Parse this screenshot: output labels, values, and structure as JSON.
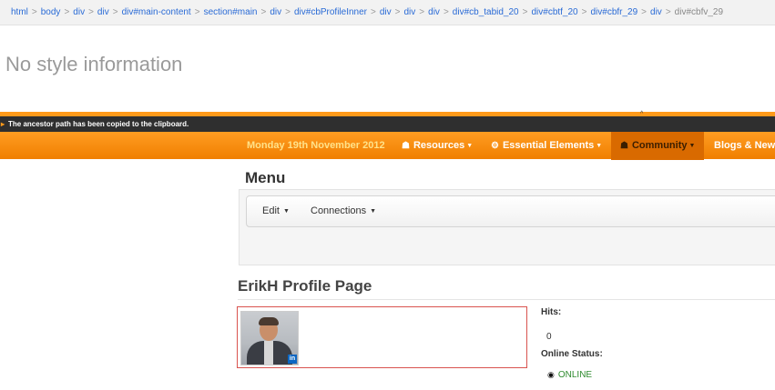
{
  "breadcrumb": [
    "html",
    "body",
    "div",
    "div",
    "div#main-content",
    "section#main",
    "div",
    "div#cbProfileInner",
    "div",
    "div",
    "div",
    "div#cb_tabid_20",
    "div#cbtf_20",
    "div#cbfr_29",
    "div",
    "div#cbfv_29"
  ],
  "no_style": "No style information",
  "toast": "The ancestor path has been copied to the clipboard.",
  "topline_mark": "^",
  "nav": {
    "date": "Monday 19th November 2012",
    "items": [
      {
        "icon": "briefcase-icon",
        "glyph": "☗",
        "label": "Resources"
      },
      {
        "icon": "cogs-icon",
        "glyph": "⚙",
        "label": "Essential Elements"
      },
      {
        "icon": "group-icon",
        "glyph": "☗",
        "label": "Community"
      },
      {
        "label": "Blogs & News"
      }
    ]
  },
  "menu": {
    "title": "Menu",
    "items": [
      "Edit",
      "Connections"
    ]
  },
  "profile": {
    "title": "ErikH Profile Page",
    "linkedin_badge": "in",
    "hits_label": "Hits:",
    "hits_value": "0",
    "status_label": "Online Status:",
    "status_value": "ONLINE",
    "status_color": "#2e8b2e"
  },
  "colors": {
    "accent": "#ff9a1a",
    "toast_bg": "#2f2f2f",
    "link": "#2a6bd6"
  }
}
